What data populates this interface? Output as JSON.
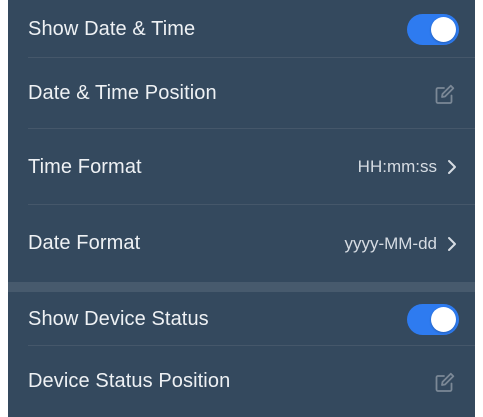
{
  "settings": {
    "show_date_time": {
      "label": "Show Date & Time",
      "enabled": true
    },
    "date_time_position": {
      "label": "Date & Time Position",
      "icon": "edit-icon"
    },
    "time_format": {
      "label": "Time Format",
      "value": "HH:mm:ss",
      "icon": "chevron-right-icon"
    },
    "date_format": {
      "label": "Date Format",
      "value": "yyyy-MM-dd",
      "icon": "chevron-right-icon"
    },
    "show_device_status": {
      "label": "Show Device Status",
      "enabled": true
    },
    "device_status_position": {
      "label": "Device Status Position",
      "icon": "edit-icon"
    }
  },
  "colors": {
    "panel_background": "#34495e",
    "toggle_on": "#2e7bf0",
    "text": "#eef1f4",
    "value_text": "#d6dce3",
    "icon_gray": "#7b8896"
  }
}
